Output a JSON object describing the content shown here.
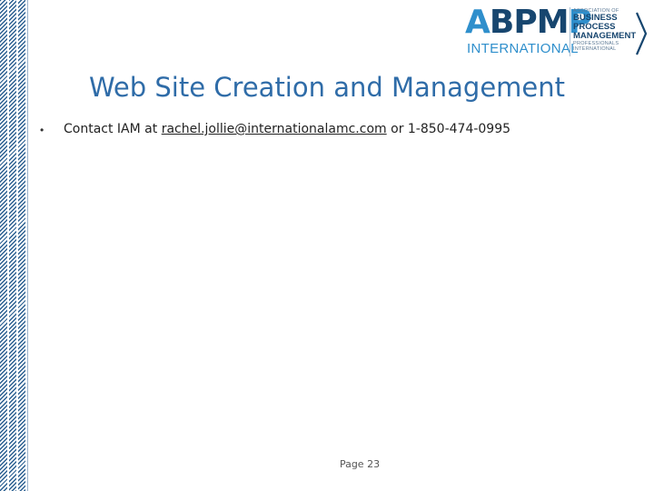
{
  "logo": {
    "abpmp_a": "A",
    "abpmp_bpm": "BPM",
    "abpmp_p": "P",
    "international": "INTERNATIONAL",
    "line1": "ASSOCIATION OF",
    "line2": "BUSINESS",
    "line3": "PROCESS",
    "line4": "MANAGEMENT",
    "line5": "PROFESSIONALS",
    "line6": "INTERNATIONAL"
  },
  "slide": {
    "title": "Web Site Creation and Management",
    "bullet": {
      "prefix": "Contact IAM at ",
      "email": "rachel.jollie@internationalamc.com",
      "suffix": " or 1-850-474-0995"
    },
    "page_number": "Page 23"
  },
  "colors": {
    "title": "#2f6ca8",
    "logo_light_blue": "#2f8fcc",
    "logo_dark_blue": "#17466f",
    "stripe": "#2b5f91"
  }
}
